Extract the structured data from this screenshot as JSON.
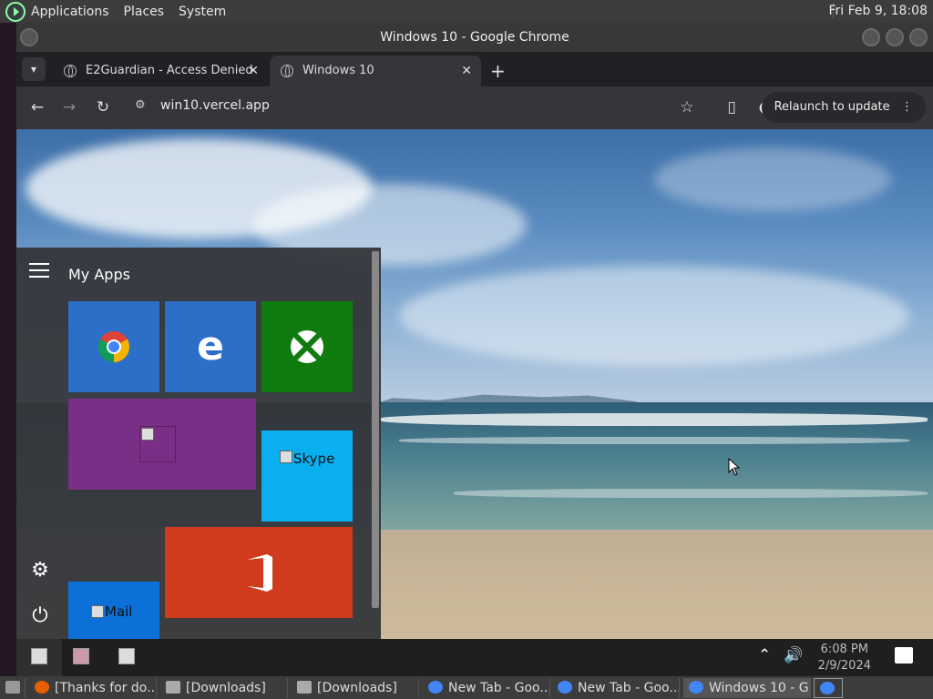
{
  "top_panel": {
    "menus": [
      "Applications",
      "Places",
      "System"
    ],
    "clock": "Fri Feb  9, 18:08"
  },
  "window": {
    "title": "Windows 10 - Google Chrome"
  },
  "tabs": [
    {
      "label": "E2Guardian - Access Denied",
      "close": "✕"
    },
    {
      "label": "Windows 10",
      "close": "✕"
    }
  ],
  "toolbar": {
    "url": "win10.vercel.app",
    "relaunch_label": "Relaunch to update"
  },
  "start_menu": {
    "title": "My Apps",
    "tiles": {
      "skype_alt": "Skype",
      "mail_alt": "Mail"
    }
  },
  "win_taskbar": {
    "time": "6:08 PM",
    "date": "2/9/2024"
  },
  "bottom_panel": {
    "items": [
      {
        "label": "[Thanks for do..."
      },
      {
        "label": "[Downloads]"
      },
      {
        "label": "[Downloads]"
      },
      {
        "label": "New Tab - Goo..."
      },
      {
        "label": "New Tab - Goo..."
      },
      {
        "label": "Windows 10 - G..."
      }
    ]
  },
  "colors": {
    "chrome_tile": "#2c6fc9",
    "edge_tile": "#2c6fc9",
    "xbox_tile": "#107c10",
    "purple_tile": "#7a2f86",
    "skype_tile": "#0aaff0",
    "office_tile": "#d03b1e",
    "mail_tile": "#0b70d8"
  }
}
